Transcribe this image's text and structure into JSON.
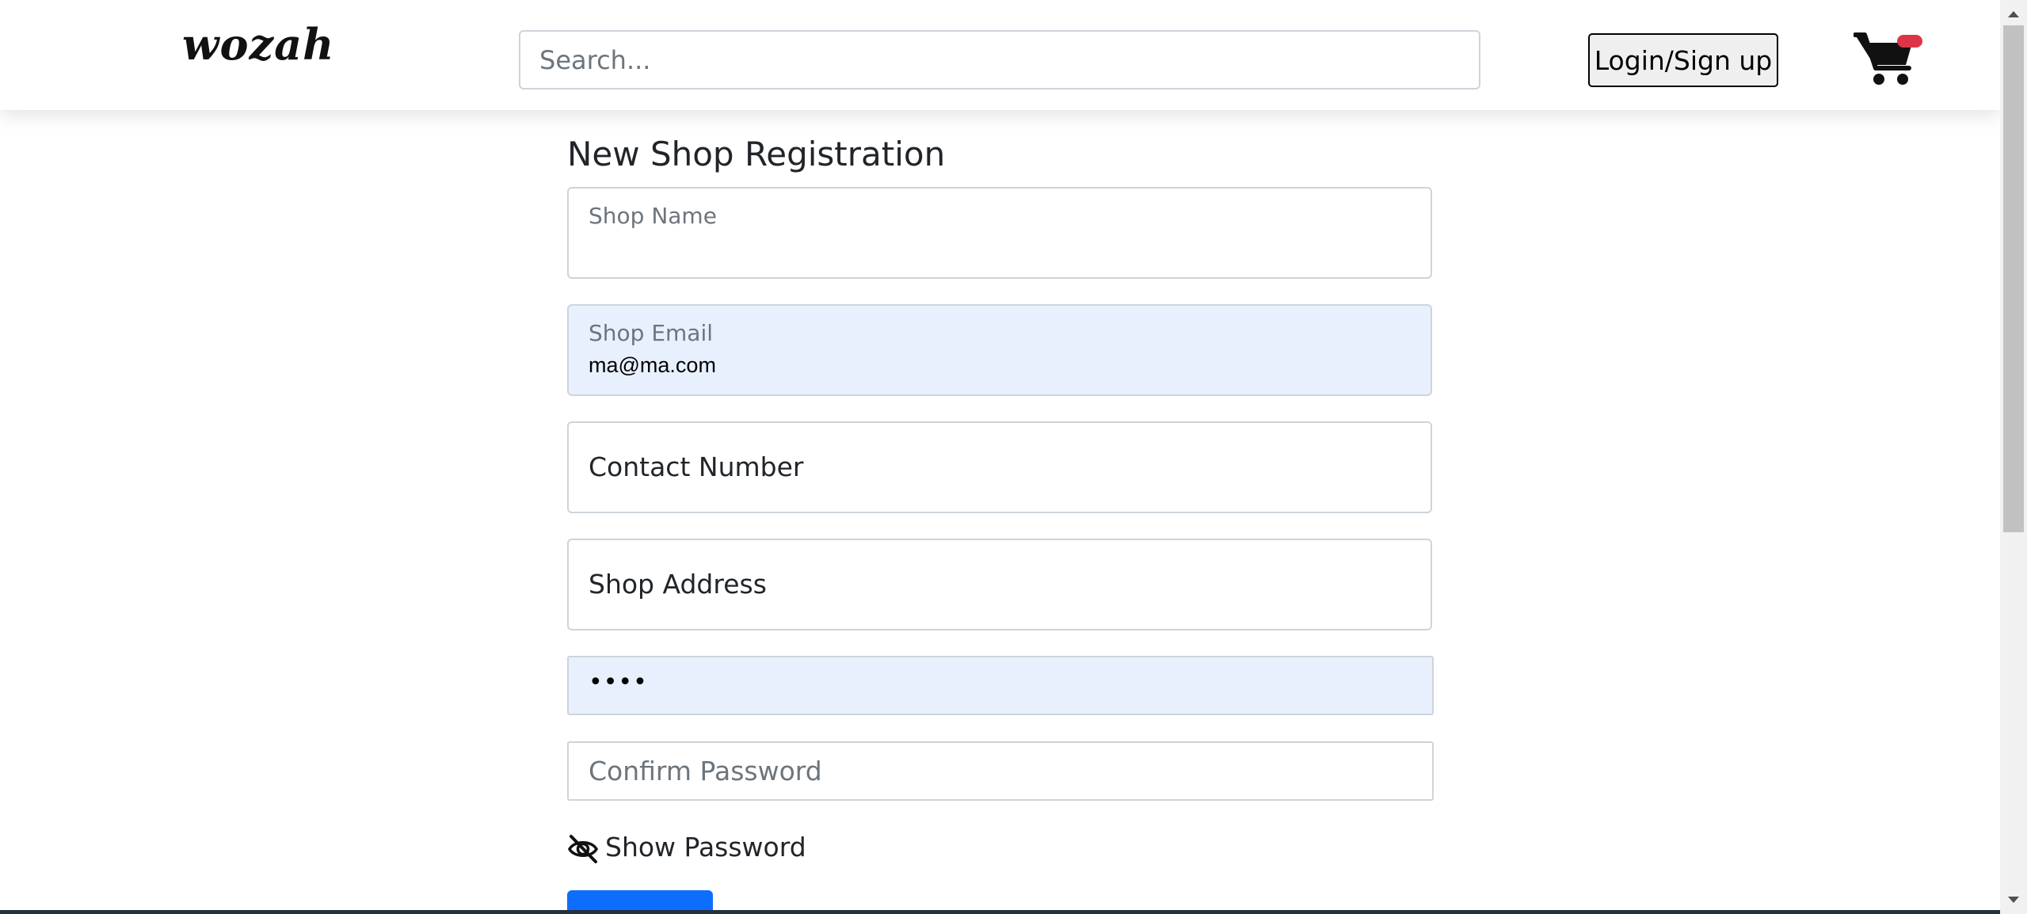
{
  "navbar": {
    "logo": "wozah",
    "search_placeholder": "Search...",
    "login_label": "Login/Sign up",
    "cart_icon": "cart-icon",
    "cart_badge_color": "#dc3545"
  },
  "form": {
    "title": "New Shop Registration",
    "shop_name_label": "Shop Name",
    "shop_email_label": "Shop Email",
    "shop_email_value": "ma@ma.com",
    "contact_label": "Contact Number",
    "address_label": "Shop Address",
    "password_mask": "••••",
    "confirm_placeholder": "Confirm Password",
    "show_password_label": "Show Password",
    "show_password_icon": "eye-slash-icon",
    "submit_color": "#0d6efd"
  },
  "colors": {
    "autofill_bg": "#e8f0fe",
    "border": "#ced4da"
  }
}
